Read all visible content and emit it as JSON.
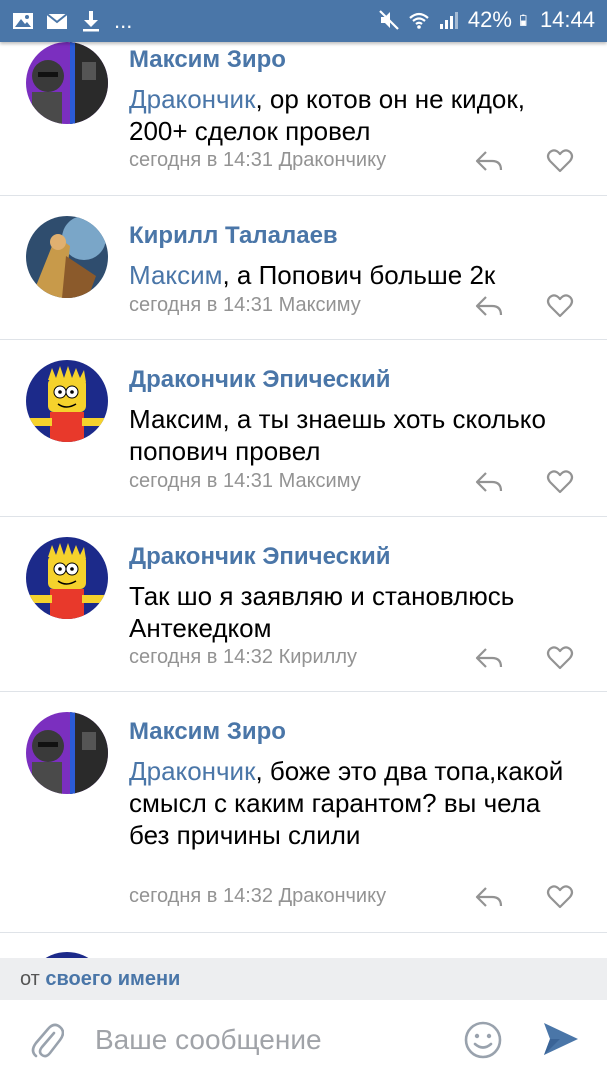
{
  "status_bar": {
    "dots": "...",
    "battery_percent": "42%",
    "time": "14:44",
    "icons": [
      "image-icon",
      "mail-icon",
      "download-icon",
      "mute-icon",
      "wifi-icon",
      "signal-icon",
      "battery-icon"
    ]
  },
  "comments": [
    {
      "author": "Максим Зиро",
      "mention": "Дракончик",
      "text": ", ор котов он не кидок, 200+ сделок провел",
      "time": "сегодня в 14:31",
      "reply_to": "Дракончику",
      "avatar": "robber"
    },
    {
      "author": "Кирилл Талалаев",
      "mention": "Максим",
      "text": ", а Попович больше 2к",
      "time": "сегодня в 14:31",
      "reply_to": "Максиму",
      "avatar": "warrior"
    },
    {
      "author": "Дракончик Эпический",
      "mention": "",
      "text": "Максим, а ты знаешь хоть сколько попович провел",
      "time": "сегодня в 14:31",
      "reply_to": "Максиму",
      "avatar": "bart"
    },
    {
      "author": "Дракончик Эпический",
      "mention": "",
      "text": "Так шо я заявляю и становлюсь Антекедком",
      "time": "сегодня в 14:32",
      "reply_to": "Кириллу",
      "avatar": "bart"
    },
    {
      "author": "Максим Зиро",
      "mention": "Дракончик",
      "text": ", боже это два топа,какой смысл с каким гарантом? вы чела без причины слили",
      "time": "сегодня в 14:32",
      "reply_to": "Дракончику",
      "avatar": "robber"
    }
  ],
  "sender": {
    "prefix": "от",
    "name": "своего имени"
  },
  "composer": {
    "placeholder": "Ваше сообщение"
  },
  "colors": {
    "accent": "#4a76a8",
    "meta": "#939393",
    "divider": "#dfe3e8"
  }
}
